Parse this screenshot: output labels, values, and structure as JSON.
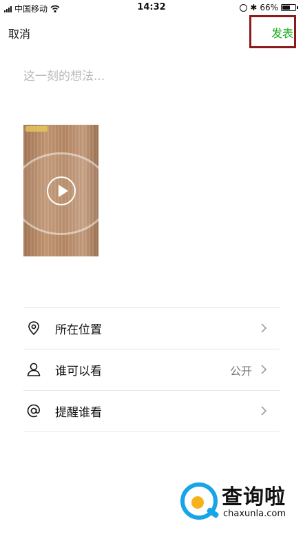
{
  "status_bar": {
    "carrier": "中国移动",
    "time": "14:32",
    "battery": "66%",
    "battery_level": 0.66
  },
  "nav": {
    "cancel": "取消",
    "publish": "发表"
  },
  "composer": {
    "placeholder": "这一刻的想法..."
  },
  "options": [
    {
      "label": "所在位置",
      "value": ""
    },
    {
      "label": "谁可以看",
      "value": "公开"
    },
    {
      "label": "提醒谁看",
      "value": ""
    }
  ],
  "watermark": {
    "title": "查询啦",
    "url": "chaxunla.com"
  },
  "colors": {
    "accent_green": "#1aad19",
    "highlight_box": "#8b1a1a"
  }
}
